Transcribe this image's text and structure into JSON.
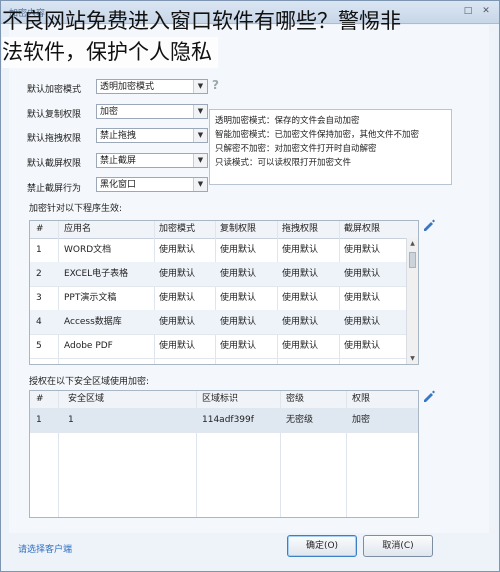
{
  "window": {
    "title": "加密内容"
  },
  "overlay": {
    "line1": "不良网站免费进入窗口软件有哪些？警惕非",
    "line2": "法软件，保护个人隐私"
  },
  "settings": [
    {
      "label": "默认加密模式",
      "value": "透明加密模式"
    },
    {
      "label": "默认复制权限",
      "value": "加密"
    },
    {
      "label": "默认拖拽权限",
      "value": "禁止拖拽"
    },
    {
      "label": "默认截屏权限",
      "value": "禁止截屏"
    },
    {
      "label": "禁止截屏行为",
      "value": "黑化窗口"
    }
  ],
  "help_mark": "?",
  "info_lines": [
    "透明加密模式：保存的文件会自动加密",
    "智能加密模式：已加密文件保持加密，其他文件不加密",
    "只解密不加密：对加密文件打开时自动解密",
    "只读模式：可以读权限打开加密文件"
  ],
  "programs": {
    "section_label": "加密针对以下程序生效:",
    "columns": [
      "#",
      "应用名",
      "加密模式",
      "复制权限",
      "拖拽权限",
      "截屏权限"
    ],
    "rows": [
      [
        "1",
        "WORD文档",
        "使用默认",
        "使用默认",
        "使用默认",
        "使用默认"
      ],
      [
        "2",
        "EXCEL电子表格",
        "使用默认",
        "使用默认",
        "使用默认",
        "使用默认"
      ],
      [
        "3",
        "PPT演示文稿",
        "使用默认",
        "使用默认",
        "使用默认",
        "使用默认"
      ],
      [
        "4",
        "Access数据库",
        "使用默认",
        "使用默认",
        "使用默认",
        "使用默认"
      ],
      [
        "5",
        "Adobe PDF",
        "使用默认",
        "使用默认",
        "使用默认",
        "使用默认"
      ]
    ]
  },
  "zones": {
    "section_label": "授权在以下安全区域使用加密:",
    "columns": [
      "#",
      "安全区域",
      "区域标识",
      "密级",
      "权限"
    ],
    "rows": [
      [
        "1",
        "1",
        "114adf399f",
        "无密级",
        "加密"
      ]
    ]
  },
  "footer": {
    "link": "请选择客户端",
    "ok": "确定(O)",
    "cancel": "取消(C)"
  },
  "colors": {
    "accent": "#3c7fc4",
    "link": "#2f6fc0",
    "edit_icon": "#3a78c2"
  }
}
